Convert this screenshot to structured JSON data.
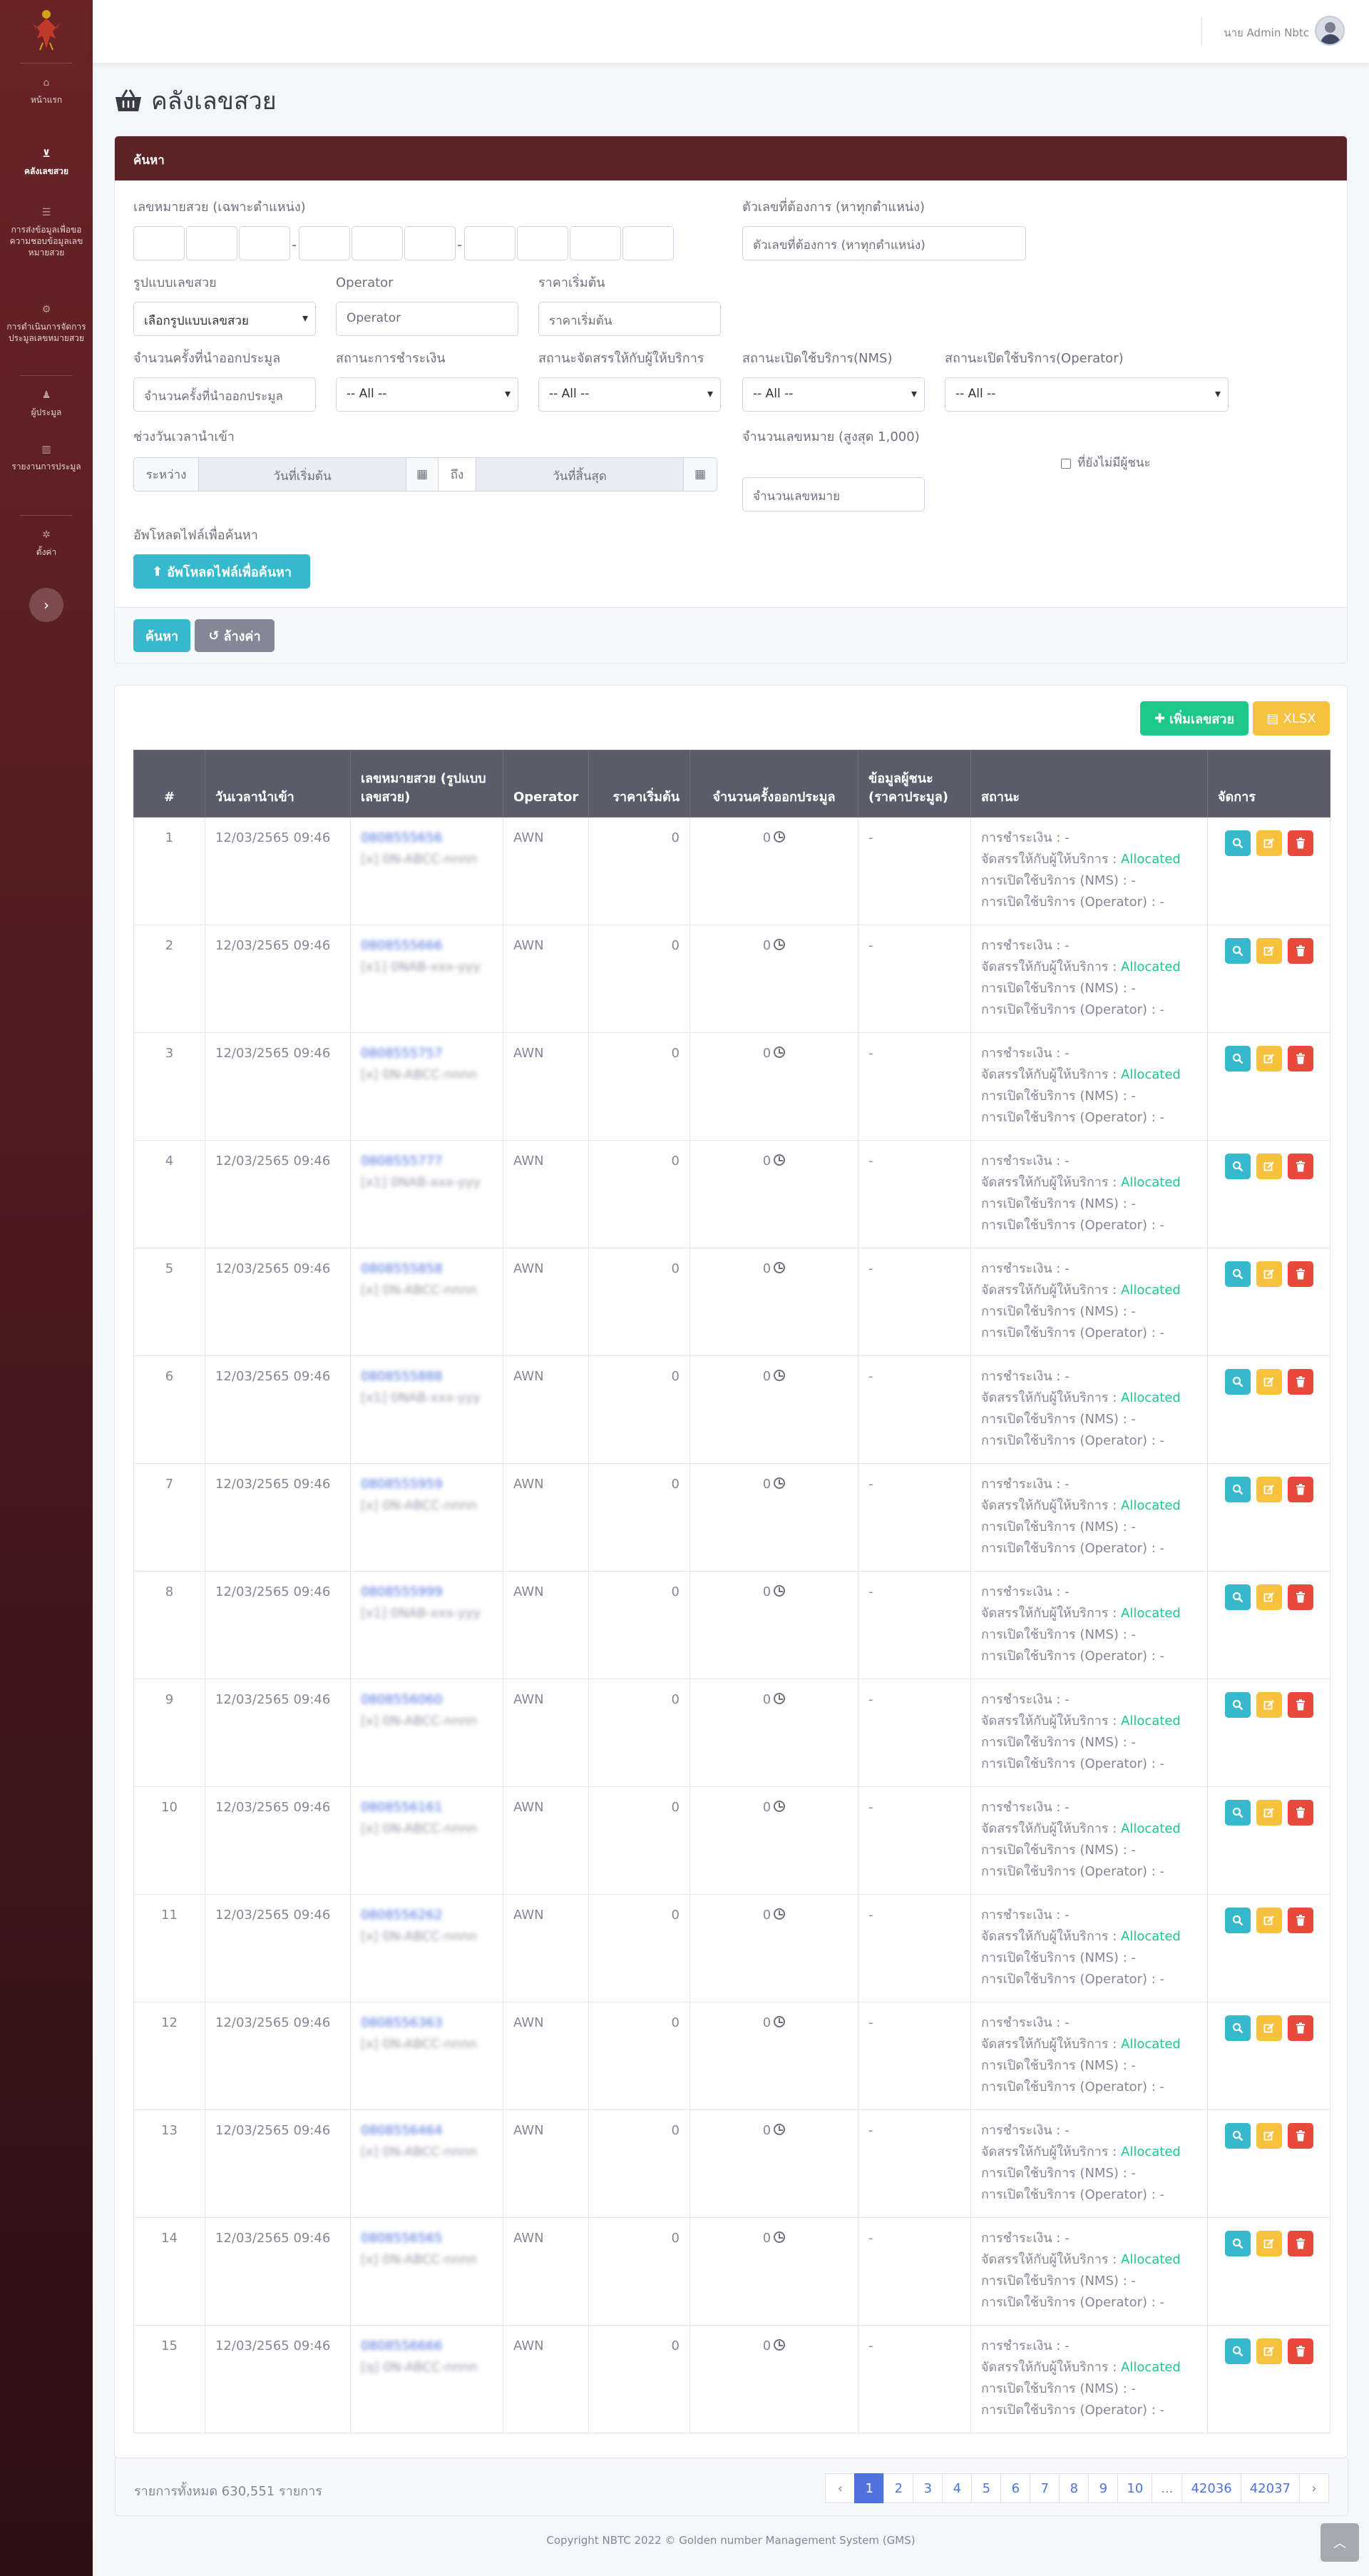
{
  "sidebar": {
    "items": [
      {
        "label": "หน้าแรก",
        "icon": "home-icon"
      },
      {
        "label": "คลังเลขสวย",
        "icon": "basket-icon"
      },
      {
        "label": "การส่งข้อมูลเพื่อขอความชอบข้อมูลเลขหมายสวย",
        "icon": "list-icon"
      },
      {
        "label": "การดำเนินการจัดการประมูลเลขหมายสวย",
        "icon": "gavel-icon"
      },
      {
        "label": "ผู้ประมูล",
        "icon": "user-icon"
      },
      {
        "label": "รายงานการประมูล",
        "icon": "book-icon"
      },
      {
        "label": "ตั้งค่า",
        "icon": "gear-icon"
      }
    ]
  },
  "topbar": {
    "user_name": "นาย Admin Nbtc"
  },
  "page": {
    "title": "คลังเลขสวย"
  },
  "search": {
    "header": "ค้นหา",
    "number_label": "เลขหมายสวย (เฉพาะตำแหน่ง)",
    "contains_label": "ตัวเลขที่ต้องการ (หาทุกตำแหน่ง)",
    "contains_placeholder": "ตัวเลขที่ต้องการ (หาทุกตำแหน่ง)",
    "format_label": "รูปแบบเลขสวย",
    "format_value": "เลือกรูปแบบเลขสวย",
    "operator_label": "Operator",
    "operator_placeholder": "Operator",
    "price_label": "ราคาเริ่มต้น",
    "price_placeholder": "ราคาเริ่มต้น",
    "times_label": "จำนวนครั้งที่นำออกประมูล",
    "times_placeholder": "จำนวนครั้งที่นำออกประมูล",
    "payment_label": "สถานะการชำระเงิน",
    "allocate_label": "สถานะจัดสรรให้กับผู้ให้บริการ",
    "nms_label": "สถานะเปิดใช้บริการ(NMS)",
    "op_status_label": "สถานะเปิดใช้บริการ(Operator)",
    "all_option": "-- All --",
    "date_label": "ช่วงวันเวลานำเข้า",
    "between": "ระหว่าง",
    "start_placeholder": "วันที่เริ่มต้น",
    "to": "ถึง",
    "end_placeholder": "วันที่สิ้นสุด",
    "qty_label": "จำนวนเลขหมาย (สูงสุด 1,000)",
    "qty_placeholder": "จำนวนเลขหมาย",
    "no_winner_label": "ที่ยังไม่มีผู้ชนะ",
    "upload_label": "อัพโหลดไฟล์เพื่อค้นหา",
    "upload_button": "อัพโหลดไฟล์เพื่อค้นหา",
    "search_button": "ค้นหา",
    "clear_button": "ล้างค่า"
  },
  "toolbar": {
    "add_button": "เพิ่มเลขสวย",
    "xlsx_button": "XLSX"
  },
  "table": {
    "headers": [
      "#",
      "วันเวลานำเข้า",
      "เลขหมายสวย (รูปแบบเลขสวย)",
      "Operator",
      "ราคาเริ่มต้น",
      "จำนวนครั้งออกประมูล",
      "ข้อมูลผู้ชนะ (ราคาประมูล)",
      "สถานะ",
      "จัดการ"
    ],
    "status_labels": {
      "payment": "การชำระเงิน : -",
      "allocate": "จัดสรรให้กับผู้ให้บริการ : ",
      "nms": "การเปิดใช้บริการ (NMS) : -",
      "operator": "การเปิดใช้บริการ (Operator) : -"
    },
    "rows": [
      {
        "no": "1",
        "date": "12/03/2565 09:46",
        "number": "0808555656",
        "format": "[x] 0N-ABCC-nnnn",
        "operator": "AWN",
        "price": "0",
        "times": "0",
        "winner": "-",
        "allocated": "Allocated"
      },
      {
        "no": "2",
        "date": "12/03/2565 09:46",
        "number": "0808555666",
        "format": "[x1] 0NAB-xxx-yyy",
        "operator": "AWN",
        "price": "0",
        "times": "0",
        "winner": "-",
        "allocated": "Allocated"
      },
      {
        "no": "3",
        "date": "12/03/2565 09:46",
        "number": "0808555757",
        "format": "[x] 0N-ABCC-nnnn",
        "operator": "AWN",
        "price": "0",
        "times": "0",
        "winner": "-",
        "allocated": "Allocated"
      },
      {
        "no": "4",
        "date": "12/03/2565 09:46",
        "number": "0808555777",
        "format": "[x1] 0NAB-xxx-yyy",
        "operator": "AWN",
        "price": "0",
        "times": "0",
        "winner": "-",
        "allocated": "Allocated"
      },
      {
        "no": "5",
        "date": "12/03/2565 09:46",
        "number": "0808555858",
        "format": "[x] 0N-ABCC-nnnn",
        "operator": "AWN",
        "price": "0",
        "times": "0",
        "winner": "-",
        "allocated": "Allocated"
      },
      {
        "no": "6",
        "date": "12/03/2565 09:46",
        "number": "0808555888",
        "format": "[x1] 0NAB-xxx-yyy",
        "operator": "AWN",
        "price": "0",
        "times": "0",
        "winner": "-",
        "allocated": "Allocated"
      },
      {
        "no": "7",
        "date": "12/03/2565 09:46",
        "number": "0808555959",
        "format": "[x] 0N-ABCC-nnnn",
        "operator": "AWN",
        "price": "0",
        "times": "0",
        "winner": "-",
        "allocated": "Allocated"
      },
      {
        "no": "8",
        "date": "12/03/2565 09:46",
        "number": "0808555999",
        "format": "[x1] 0NAB-xxx-yyy",
        "operator": "AWN",
        "price": "0",
        "times": "0",
        "winner": "-",
        "allocated": "Allocated"
      },
      {
        "no": "9",
        "date": "12/03/2565 09:46",
        "number": "0808556060",
        "format": "[x] 0N-ABCC-nnnn",
        "operator": "AWN",
        "price": "0",
        "times": "0",
        "winner": "-",
        "allocated": "Allocated"
      },
      {
        "no": "10",
        "date": "12/03/2565 09:46",
        "number": "0808556161",
        "format": "[x] 0N-ABCC-nnnn",
        "operator": "AWN",
        "price": "0",
        "times": "0",
        "winner": "-",
        "allocated": "Allocated"
      },
      {
        "no": "11",
        "date": "12/03/2565 09:46",
        "number": "0808556262",
        "format": "[x] 0N-ABCC-nnnn",
        "operator": "AWN",
        "price": "0",
        "times": "0",
        "winner": "-",
        "allocated": "Allocated"
      },
      {
        "no": "12",
        "date": "12/03/2565 09:46",
        "number": "0808556363",
        "format": "[x] 0N-ABCC-nnnn",
        "operator": "AWN",
        "price": "0",
        "times": "0",
        "winner": "-",
        "allocated": "Allocated"
      },
      {
        "no": "13",
        "date": "12/03/2565 09:46",
        "number": "0808556464",
        "format": "[x] 0N-ABCC-nnnn",
        "operator": "AWN",
        "price": "0",
        "times": "0",
        "winner": "-",
        "allocated": "Allocated"
      },
      {
        "no": "14",
        "date": "12/03/2565 09:46",
        "number": "0808556565",
        "format": "[x] 0N-ABCC-nnnn",
        "operator": "AWN",
        "price": "0",
        "times": "0",
        "winner": "-",
        "allocated": "Allocated"
      },
      {
        "no": "15",
        "date": "12/03/2565 09:46",
        "number": "0808556666",
        "format": "[q] 0N-ABCC-nnnn",
        "operator": "AWN",
        "price": "0",
        "times": "0",
        "winner": "-",
        "allocated": "Allocated"
      }
    ],
    "total": "รายการทั้งหมด 630,551 รายการ"
  },
  "pagination": {
    "prev": "‹",
    "pages": [
      "1",
      "2",
      "3",
      "4",
      "5",
      "6",
      "7",
      "8",
      "9",
      "10",
      "...",
      "42036",
      "42037"
    ],
    "next": "›",
    "active": "1"
  },
  "footer": {
    "text": "Copyright NBTC 2022 © Golden number Management System (GMS)"
  },
  "colors": {
    "brand": "#5d2428",
    "info": "#36b9cc",
    "success": "#1cc88a",
    "warning": "#f6c23e",
    "danger": "#e74a3b",
    "primary": "#4e73df"
  }
}
